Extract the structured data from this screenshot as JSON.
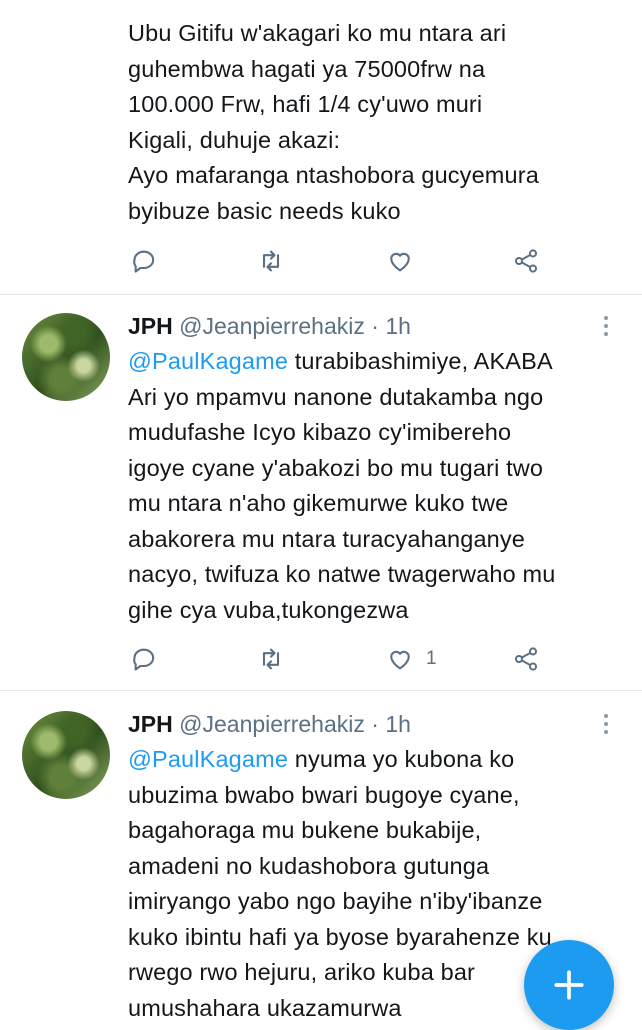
{
  "tweets": [
    {
      "text_lines": "Ubu Gitifu w'akagari ko mu ntara ari\nguhembwa hagati ya 75000frw na\n100.000 Frw, hafi 1/4 cy'uwo muri\nKigali, duhuje akazi:\nAyo mafaranga ntashobora gucyemura\nbyibuze basic needs kuko",
      "likes": ""
    },
    {
      "name": "JPH",
      "handle": "@Jeanpierrehakiz",
      "sep": "·",
      "time": "1h",
      "mention": "@PaulKagame",
      "text_lines": " turabibashimiye, AKABA\nAri yo mpamvu nanone dutakamba ngo\nmudufashe Icyo kibazo cy'imibereho\nigoye cyane y'abakozi bo mu tugari two\nmu ntara n'aho gikemurwe  kuko twe\nabakorera mu ntara turacyahanganye\nnacyo, twifuza ko natwe twagerwaho mu\ngihe cya vuba,tukongezwa",
      "likes": "1"
    },
    {
      "name": "JPH",
      "handle": "@Jeanpierrehakiz",
      "sep": "·",
      "time": "1h",
      "mention": "@PaulKagame",
      "text_lines": " nyuma yo kubona ko\nubuzima bwabo bwari bugoye cyane,\nbagahoraga mu bukene bukabije,\namadeni no kudashobora gutunga\nimiryango yabo ngo bayihe n'iby'ibanze\nkuko ibintu hafi ya byose byarahenze ku\nrwego rwo hejuru, ariko kuba bar\numushahara ukazamurwa"
    }
  ],
  "icons": [
    "reply-icon",
    "retweet-icon",
    "like-icon",
    "share-icon",
    "more-icon",
    "compose-plus-icon"
  ],
  "colors": {
    "accent": "#1d9bf0",
    "text": "#14171a",
    "secondary": "#5b7083",
    "divider": "#e4e8eb"
  }
}
